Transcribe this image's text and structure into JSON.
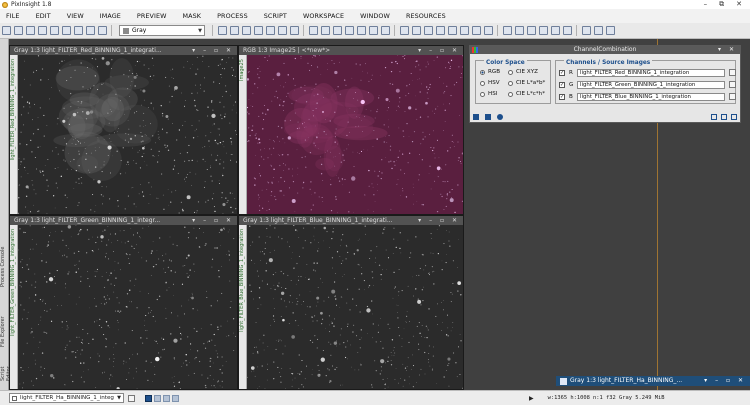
{
  "window": {
    "title": "PixInsight 1.8",
    "controls": [
      "–",
      "⧉",
      "✕"
    ]
  },
  "menu": [
    "FILE",
    "EDIT",
    "VIEW",
    "IMAGE",
    "PREVIEW",
    "MASK",
    "PROCESS",
    "SCRIPT",
    "WORKSPACE",
    "WINDOW",
    "RESOURCES"
  ],
  "toolbar": {
    "colorspace_select": "Gray"
  },
  "rail_tabs": [
    "Process Console",
    "File Explorer",
    "Script Editor"
  ],
  "images": [
    {
      "title": "Gray 1:3 light_FILTER_Red_BINNING_1_integrati...",
      "id": "light_FILTER_Red_BINNING_1_integration",
      "active": false,
      "tint": "gray"
    },
    {
      "title": "RGB 1:3 Image25 | <*new*>",
      "id": "Image25",
      "active": false,
      "tint": "magenta"
    },
    {
      "title": "Gray 1:3 light_FILTER_Green_BINNING_1_integr...",
      "id": "light_FILTER_Green_BINNING_1_integration",
      "active": false,
      "tint": "gray"
    },
    {
      "title": "Gray 1:3 light_FILTER_Blue_BINNING_1_integrati...",
      "id": "light_FILTER_Blue_BINNING_1_integration",
      "active": false,
      "tint": "gray"
    }
  ],
  "channel_combination": {
    "title": "ChannelCombination",
    "color_space_label": "Color Space",
    "color_spaces": [
      {
        "label": "RGB",
        "selected": true
      },
      {
        "label": "CIE XYZ",
        "selected": false
      },
      {
        "label": "HSV",
        "selected": false
      },
      {
        "label": "CIE L*a*b*",
        "selected": false
      },
      {
        "label": "HSI",
        "selected": false
      },
      {
        "label": "CIE L*c*h*",
        "selected": false
      }
    ],
    "channels_label": "Channels / Source Images",
    "channels": [
      {
        "label": "R",
        "checked": true,
        "source": "light_FILTER_Red_BINNING_1_integration"
      },
      {
        "label": "G",
        "checked": true,
        "source": "light_FILTER_Green_BINNING_1_integration"
      },
      {
        "label": "B",
        "checked": true,
        "source": "light_FILTER_Blue_BINNING_1_integration"
      }
    ]
  },
  "iconized_window": {
    "title": "Gray 1:3 light_FILTER_Ha_BINNING_..."
  },
  "statusbar": {
    "view_select": "light_FILTER_Ha_BINNING_1_integ",
    "info": "w:1365  h:1008  n:1  f32  Gray  5.249 MiB"
  }
}
